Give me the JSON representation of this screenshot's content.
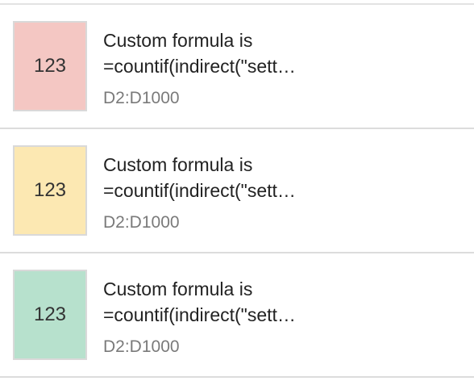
{
  "rules": [
    {
      "preview_text": "123",
      "condition_line1": "Custom formula is",
      "condition_line2": "=countif(indirect(\"sett…",
      "range": "D2:D1000",
      "preview_color": "#f4c7c3"
    },
    {
      "preview_text": "123",
      "condition_line1": "Custom formula is",
      "condition_line2": "=countif(indirect(\"sett…",
      "range": "D2:D1000",
      "preview_color": "#fce8b2"
    },
    {
      "preview_text": "123",
      "condition_line1": "Custom formula is",
      "condition_line2": "=countif(indirect(\"sett…",
      "range": "D2:D1000",
      "preview_color": "#b7e1cd"
    }
  ]
}
